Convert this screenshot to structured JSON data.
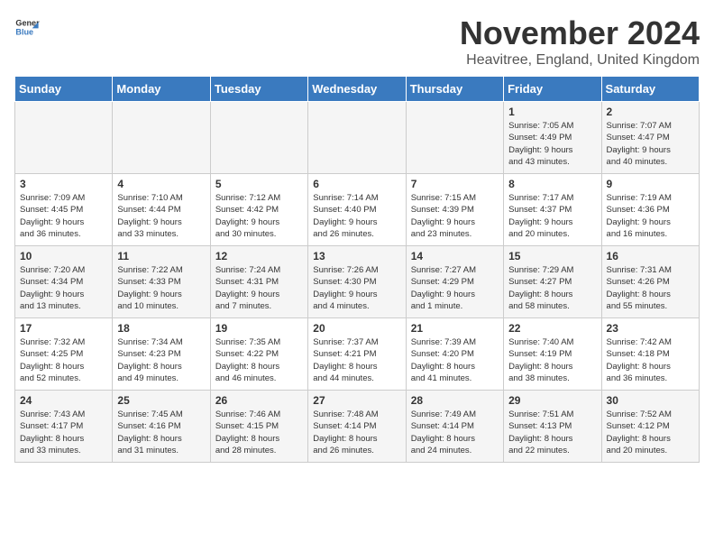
{
  "logo": {
    "general": "General",
    "blue": "Blue"
  },
  "title": "November 2024",
  "location": "Heavitree, England, United Kingdom",
  "days_of_week": [
    "Sunday",
    "Monday",
    "Tuesday",
    "Wednesday",
    "Thursday",
    "Friday",
    "Saturday"
  ],
  "weeks": [
    [
      {
        "day": "",
        "info": ""
      },
      {
        "day": "",
        "info": ""
      },
      {
        "day": "",
        "info": ""
      },
      {
        "day": "",
        "info": ""
      },
      {
        "day": "",
        "info": ""
      },
      {
        "day": "1",
        "info": "Sunrise: 7:05 AM\nSunset: 4:49 PM\nDaylight: 9 hours\nand 43 minutes."
      },
      {
        "day": "2",
        "info": "Sunrise: 7:07 AM\nSunset: 4:47 PM\nDaylight: 9 hours\nand 40 minutes."
      }
    ],
    [
      {
        "day": "3",
        "info": "Sunrise: 7:09 AM\nSunset: 4:45 PM\nDaylight: 9 hours\nand 36 minutes."
      },
      {
        "day": "4",
        "info": "Sunrise: 7:10 AM\nSunset: 4:44 PM\nDaylight: 9 hours\nand 33 minutes."
      },
      {
        "day": "5",
        "info": "Sunrise: 7:12 AM\nSunset: 4:42 PM\nDaylight: 9 hours\nand 30 minutes."
      },
      {
        "day": "6",
        "info": "Sunrise: 7:14 AM\nSunset: 4:40 PM\nDaylight: 9 hours\nand 26 minutes."
      },
      {
        "day": "7",
        "info": "Sunrise: 7:15 AM\nSunset: 4:39 PM\nDaylight: 9 hours\nand 23 minutes."
      },
      {
        "day": "8",
        "info": "Sunrise: 7:17 AM\nSunset: 4:37 PM\nDaylight: 9 hours\nand 20 minutes."
      },
      {
        "day": "9",
        "info": "Sunrise: 7:19 AM\nSunset: 4:36 PM\nDaylight: 9 hours\nand 16 minutes."
      }
    ],
    [
      {
        "day": "10",
        "info": "Sunrise: 7:20 AM\nSunset: 4:34 PM\nDaylight: 9 hours\nand 13 minutes."
      },
      {
        "day": "11",
        "info": "Sunrise: 7:22 AM\nSunset: 4:33 PM\nDaylight: 9 hours\nand 10 minutes."
      },
      {
        "day": "12",
        "info": "Sunrise: 7:24 AM\nSunset: 4:31 PM\nDaylight: 9 hours\nand 7 minutes."
      },
      {
        "day": "13",
        "info": "Sunrise: 7:26 AM\nSunset: 4:30 PM\nDaylight: 9 hours\nand 4 minutes."
      },
      {
        "day": "14",
        "info": "Sunrise: 7:27 AM\nSunset: 4:29 PM\nDaylight: 9 hours\nand 1 minute."
      },
      {
        "day": "15",
        "info": "Sunrise: 7:29 AM\nSunset: 4:27 PM\nDaylight: 8 hours\nand 58 minutes."
      },
      {
        "day": "16",
        "info": "Sunrise: 7:31 AM\nSunset: 4:26 PM\nDaylight: 8 hours\nand 55 minutes."
      }
    ],
    [
      {
        "day": "17",
        "info": "Sunrise: 7:32 AM\nSunset: 4:25 PM\nDaylight: 8 hours\nand 52 minutes."
      },
      {
        "day": "18",
        "info": "Sunrise: 7:34 AM\nSunset: 4:23 PM\nDaylight: 8 hours\nand 49 minutes."
      },
      {
        "day": "19",
        "info": "Sunrise: 7:35 AM\nSunset: 4:22 PM\nDaylight: 8 hours\nand 46 minutes."
      },
      {
        "day": "20",
        "info": "Sunrise: 7:37 AM\nSunset: 4:21 PM\nDaylight: 8 hours\nand 44 minutes."
      },
      {
        "day": "21",
        "info": "Sunrise: 7:39 AM\nSunset: 4:20 PM\nDaylight: 8 hours\nand 41 minutes."
      },
      {
        "day": "22",
        "info": "Sunrise: 7:40 AM\nSunset: 4:19 PM\nDaylight: 8 hours\nand 38 minutes."
      },
      {
        "day": "23",
        "info": "Sunrise: 7:42 AM\nSunset: 4:18 PM\nDaylight: 8 hours\nand 36 minutes."
      }
    ],
    [
      {
        "day": "24",
        "info": "Sunrise: 7:43 AM\nSunset: 4:17 PM\nDaylight: 8 hours\nand 33 minutes."
      },
      {
        "day": "25",
        "info": "Sunrise: 7:45 AM\nSunset: 4:16 PM\nDaylight: 8 hours\nand 31 minutes."
      },
      {
        "day": "26",
        "info": "Sunrise: 7:46 AM\nSunset: 4:15 PM\nDaylight: 8 hours\nand 28 minutes."
      },
      {
        "day": "27",
        "info": "Sunrise: 7:48 AM\nSunset: 4:14 PM\nDaylight: 8 hours\nand 26 minutes."
      },
      {
        "day": "28",
        "info": "Sunrise: 7:49 AM\nSunset: 4:14 PM\nDaylight: 8 hours\nand 24 minutes."
      },
      {
        "day": "29",
        "info": "Sunrise: 7:51 AM\nSunset: 4:13 PM\nDaylight: 8 hours\nand 22 minutes."
      },
      {
        "day": "30",
        "info": "Sunrise: 7:52 AM\nSunset: 4:12 PM\nDaylight: 8 hours\nand 20 minutes."
      }
    ]
  ]
}
